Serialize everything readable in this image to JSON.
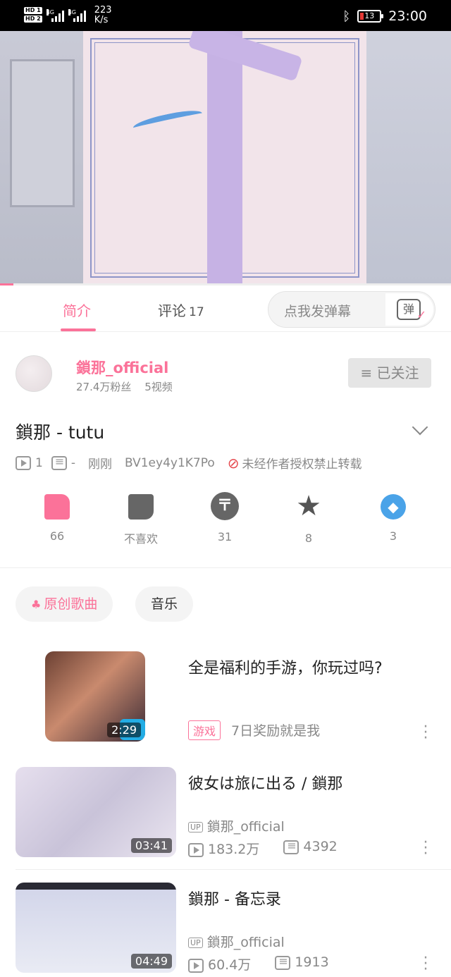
{
  "status_bar": {
    "hd1": "HD 1",
    "hd2": "HD 2",
    "net1": "4G",
    "net2": "4G",
    "speed_value": "223",
    "speed_unit": "K/s",
    "battery": "13",
    "time": "23:00"
  },
  "tabs": {
    "intro": "简介",
    "comments": "评论",
    "comments_count": "17",
    "danmaku_placeholder": "点我发弹幕",
    "danmaku_button_glyph": "弹"
  },
  "uploader": {
    "name": "鎖那_official",
    "fans": "27.4万粉丝",
    "videos": "5视频",
    "follow_label": "≡ 已关注"
  },
  "video": {
    "title": "鎖那 - tutu",
    "plays": "1",
    "danmaku": "-",
    "time": "刚刚",
    "bvid": "BV1ey4y1K7Po",
    "copyright": "未经作者授权禁止转载",
    "progress": 0.03
  },
  "actions": {
    "like": "66",
    "dislike": "不喜欢",
    "coin": "31",
    "favorite": "8",
    "share": "3"
  },
  "tags": [
    "原创歌曲",
    "音乐"
  ],
  "related": [
    {
      "title": "全是福利的手游，你玩过吗?",
      "duration": "2:29",
      "ad_tag": "游戏",
      "ad_desc": "7日奖励就是我"
    },
    {
      "title": "彼女は旅に出る / 鎖那",
      "duration": "03:41",
      "up": "鎖那_official",
      "up_badge": "UP",
      "plays": "183.2万",
      "danmaku": "4392"
    },
    {
      "title": "鎖那 - 备忘录",
      "duration": "04:49",
      "up": "鎖那_official",
      "up_badge": "UP",
      "plays": "60.4万",
      "danmaku": "1913"
    }
  ],
  "colors": {
    "accent": "#fb7299",
    "share": "#4aa3e8"
  }
}
